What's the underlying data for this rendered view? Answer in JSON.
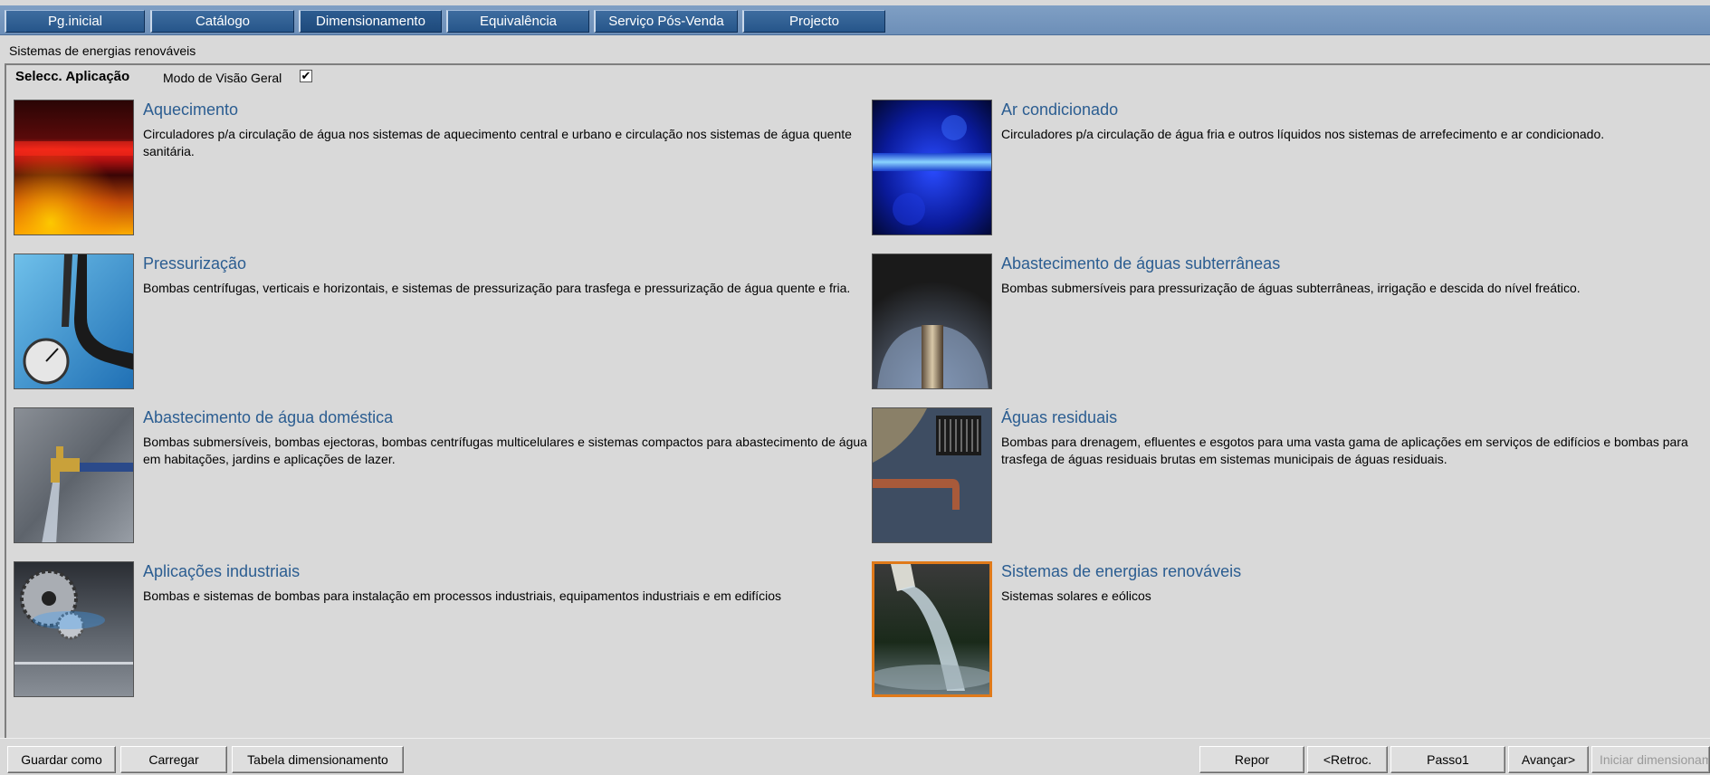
{
  "tabs": [
    {
      "label": "Pg.inicial"
    },
    {
      "label": "Catálogo"
    },
    {
      "label": "Dimensionamento"
    },
    {
      "label": "Equivalência"
    },
    {
      "label": "Serviço Pós-Venda"
    },
    {
      "label": "Projecto"
    }
  ],
  "breadcrumb": "Sistemas de energias renováveis",
  "header": {
    "title": "Selecc. Aplicação",
    "overview_label": "Modo de Visão Geral",
    "overview_checked": "✔"
  },
  "applications": [
    {
      "title": "Aquecimento",
      "description": "Circuladores p/a circulação de água nos sistemas de aquecimento central e urbano e circulação nos sistemas de água quente sanitária.",
      "image": "heating-image"
    },
    {
      "title": "Ar condicionado",
      "description": "Circuladores p/a circulação de água fria e outros líquidos nos sistemas de arrefecimento e ar condicionado.",
      "image": "air-conditioning-image"
    },
    {
      "title": "Pressurização",
      "description": "Bombas centrífugas, verticais e horizontais, e sistemas de pressurização para trasfega e pressurização de água quente e fria.",
      "image": "pressure-gauge-image"
    },
    {
      "title": "Abastecimento de águas subterrâneas",
      "description": "Bombas submersíveis para pressurização de águas subterrâneas, irrigação e descida do nível freático.",
      "image": "groundwater-image"
    },
    {
      "title": "Abastecimento de água doméstica",
      "description": "Bombas submersíveis, bombas ejectoras, bombas centrífugas multicelulares e sistemas compactos para abastecimento de água em habitações, jardins e aplicações de lazer.",
      "image": "tap-image"
    },
    {
      "title": "Águas residuais",
      "description": "Bombas para drenagem, efluentes e esgotos para uma vasta gama de aplicações em serviços de edifícios e bombas para trasfega de águas residuais brutas em sistemas municipais de águas residuais.",
      "image": "wastewater-image"
    },
    {
      "title": "Aplicações industriais",
      "description": "Bombas e sistemas de bombas para instalação em processos industriais, equipamentos industriais e em edifícios",
      "image": "industrial-image"
    },
    {
      "title": "Sistemas de energias renováveis",
      "description": "Sistemas solares e eólicos",
      "image": "renewable-water-image"
    }
  ],
  "buttons": {
    "save_as": "Guardar como",
    "load": "Carregar",
    "sizing_table": "Tabela dimensionamento",
    "reset": "Repor",
    "back": "<Retroc.",
    "step": "Passo1",
    "next": "Avançar>",
    "start": "Iniciar dimensionamento"
  },
  "colors": {
    "accent": "#2b5d91",
    "selection": "#e07a1a",
    "tab_bg": "#26568a"
  }
}
